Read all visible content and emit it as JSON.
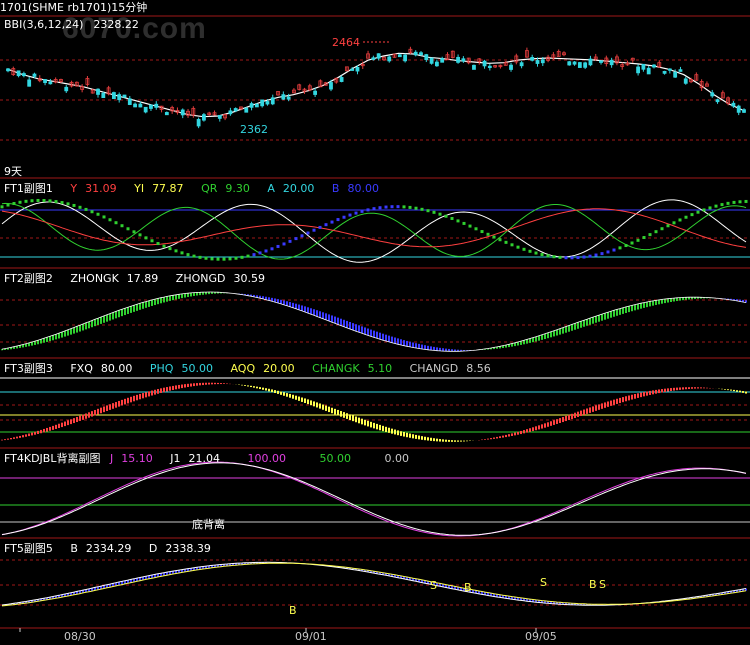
{
  "title_bar": "1701(SHME rb1701)15分钟",
  "watermark": "6070.com",
  "colors": {
    "up": "#e33d3d",
    "down": "#33d6e0",
    "frame": "#a01818",
    "white": "#ffffff",
    "yellow": "#ffff50",
    "green": "#30d030",
    "blue": "#3a3aff",
    "magenta": "#e040e0",
    "gray": "#c8c8c8",
    "red": "#ff4040"
  },
  "panels": {
    "main": {
      "label": "BBI(3,6,12,24)",
      "value": "2328.22",
      "high_label": "2464",
      "low_label": "2362",
      "period_label": "9天"
    },
    "ft1": {
      "label": "FT1副图1",
      "items": [
        {
          "name": "Y",
          "value": "31.09"
        },
        {
          "name": "YI",
          "value": "77.87"
        },
        {
          "name": "QR",
          "value": "9.30"
        },
        {
          "name": "A",
          "value": "20.00"
        },
        {
          "name": "B",
          "value": "80.00"
        }
      ]
    },
    "ft2": {
      "label": "FT2副图2",
      "items": [
        {
          "name": "ZHONGK",
          "value": "17.89"
        },
        {
          "name": "ZHONGD",
          "value": "30.59"
        }
      ]
    },
    "ft3": {
      "label": "FT3副图3",
      "items": [
        {
          "name": "FXQ",
          "value": "80.00"
        },
        {
          "name": "PHQ",
          "value": "50.00"
        },
        {
          "name": "AQQ",
          "value": "20.00"
        },
        {
          "name": "CHANGK",
          "value": "5.10"
        },
        {
          "name": "CHANGD",
          "value": "8.56"
        }
      ]
    },
    "ft4": {
      "label": "FT4KDJBL背离副图",
      "items": [
        {
          "name": "J",
          "value": "15.10"
        },
        {
          "name": "J1",
          "value": "21.04"
        },
        {
          "name": "",
          "value": "100.00"
        },
        {
          "name": "",
          "value": "50.00"
        },
        {
          "name": "",
          "value": "0.00"
        }
      ],
      "annotation": "底背离"
    },
    "ft5": {
      "label": "FT5副图5",
      "items": [
        {
          "name": "B",
          "value": "2334.29"
        },
        {
          "name": "D",
          "value": "2338.39"
        }
      ],
      "marks": [
        "B",
        "S",
        "B",
        "S",
        "B",
        "S"
      ]
    }
  },
  "x_axis_labels": [
    "08/30",
    "09/01",
    "09/05"
  ],
  "chart_data": {
    "type": "line",
    "title": "1701(SHME rb1701)15分钟",
    "x_ticks": [
      "08/30",
      "09/01",
      "09/05"
    ],
    "series": [
      {
        "name": "BBI(3,6,12,24)",
        "last": 2328.22,
        "values": [
          2436,
          2428,
          2422,
          2418,
          2414,
          2410,
          2404,
          2398,
          2392,
          2386,
          2380,
          2374,
          2368,
          2365,
          2366,
          2372,
          2380,
          2388,
          2394,
          2398,
          2404,
          2412,
          2424,
          2438,
          2450,
          2456,
          2460,
          2459,
          2454,
          2452,
          2449,
          2447,
          2445,
          2446,
          2450,
          2452,
          2453,
          2452,
          2451,
          2450,
          2448,
          2446,
          2444,
          2441,
          2436,
          2428,
          2414,
          2398,
          2384,
          2374
        ]
      },
      {
        "name": "ZHONGK",
        "last": 17.89
      },
      {
        "name": "ZHONGD",
        "last": 30.59
      },
      {
        "name": "CHANGK",
        "last": 5.1
      },
      {
        "name": "CHANGD",
        "last": 8.56
      },
      {
        "name": "J",
        "last": 15.1
      },
      {
        "name": "J1",
        "last": 21.04
      },
      {
        "name": "B",
        "last": 2334.29
      },
      {
        "name": "D",
        "last": 2338.39
      }
    ],
    "annotations": [
      {
        "text": "2464"
      },
      {
        "text": "2362"
      },
      {
        "text": "底背离"
      }
    ]
  }
}
